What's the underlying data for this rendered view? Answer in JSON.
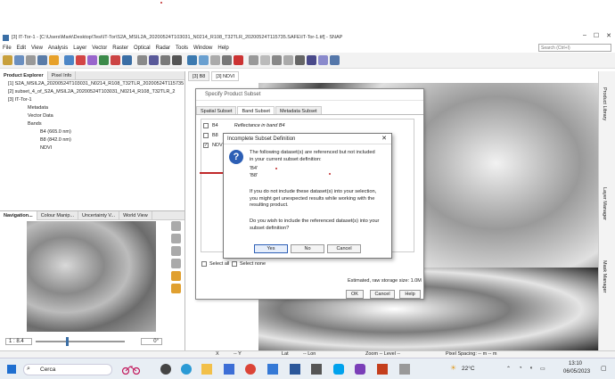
{
  "window": {
    "title": "[3] IT-Tor-1 - [C:\\Users\\Mark\\Desktop\\Tesi\\IT-Tor\\S2A_MSIL2A_20200524T103031_N0214_R108_T32TLR_20200524T115735.SAFE\\IT-Tor-1.tif] - SNAP"
  },
  "menu": {
    "items": [
      "File",
      "Edit",
      "View",
      "Analysis",
      "Raster",
      "Vector",
      "Raster",
      "Optical",
      "Radar",
      "Tools",
      "Window",
      "Help"
    ],
    "search_placeholder": "Search (Ctrl+I)"
  },
  "left_panel": {
    "tabs": [
      "Product Explorer",
      "Pixel Info"
    ],
    "tree": [
      "[1] S2A_MSIL2A_20200524T103031_N0214_R108_T32TLR_20200524T115735",
      "[2] subset_4_of_S2A_MSIL2A_20200524T103031_N0214_R108_T32TLR_2",
      "[3] IT-Tor-1",
      "Metadata",
      "Vector Data",
      "Bands",
      "B4 (665.0 nm)",
      "B8 (842.0 nm)",
      "NDVI"
    ]
  },
  "nav_panel": {
    "tabs": [
      "Navigation...",
      "Colour Manip...",
      "Uncertainty V...",
      "World View"
    ],
    "scale": "1 : 8.4",
    "rotation": "0°"
  },
  "image_tabs": [
    "[3] B8",
    "[3] NDVI"
  ],
  "right_sidebar": [
    "Product Library",
    "Layer Manager",
    "Mask Manager"
  ],
  "status_bar": {
    "x": "X",
    "y": "-- Y",
    "lat": "Lat",
    "lon": "-- Lon",
    "zoom": "Zoom -- Level --",
    "pixel_spacing": "Pixel Spacing: -- m -- m"
  },
  "subset_dialog": {
    "title": "Specify Product Subset",
    "tabs": [
      "Spatial Subset",
      "Band Subset",
      "Metadata Subset"
    ],
    "bands": [
      {
        "name": "B4",
        "desc": "Reflectance in band B4",
        "checked": false
      },
      {
        "name": "B8",
        "desc": "",
        "checked": false
      },
      {
        "name": "NDVI",
        "desc": "",
        "checked": true
      }
    ],
    "select_all": "Select all",
    "select_none": "Select none",
    "storage": "Estimated, raw storage size: 1.0M",
    "ok": "OK",
    "cancel": "Cancel",
    "help": "Help"
  },
  "alert_dialog": {
    "title": "Incomplete Subset Definition",
    "line1": "The following dataset(s) are referenced but not included",
    "line2": "in your current subset definition:",
    "ref1": "'B4'",
    "ref2": "'B8'",
    "para2_1": "If you do not include these dataset(s) into your selection,",
    "para2_2": "you might get unexpected results while working with the",
    "para2_3": "resulting product.",
    "para3_1": "Do you wish to include the referenced dataset(s) into your",
    "para3_2": "subset definition?",
    "yes": "Yes",
    "no": "No",
    "cancel": "Cancel"
  },
  "taskbar": {
    "search": "Cerca",
    "weather": "22°C",
    "time": "13:10",
    "date": "06/05/2023"
  }
}
